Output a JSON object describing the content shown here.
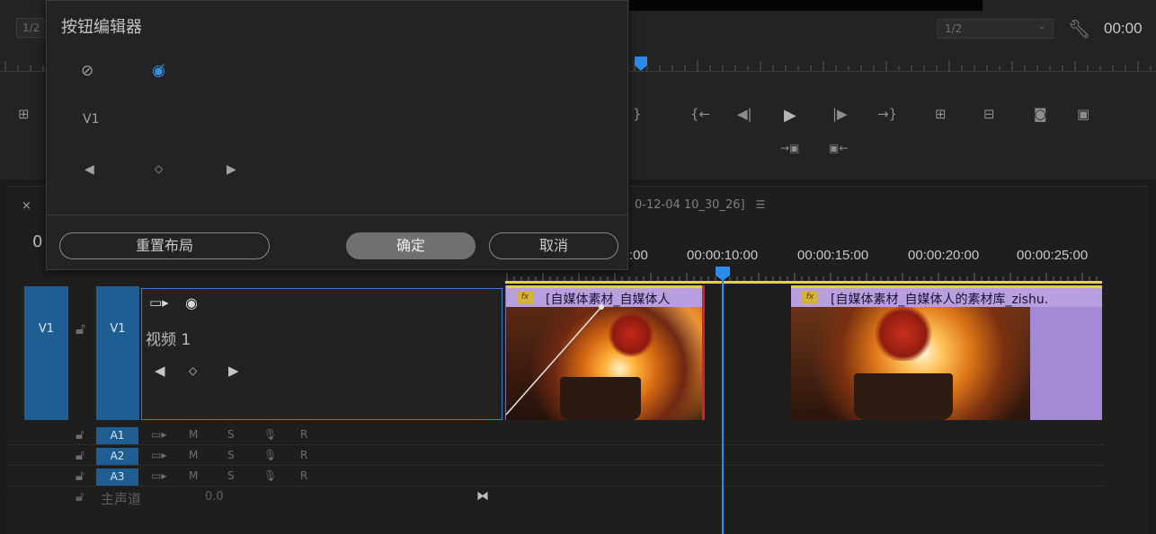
{
  "monitor": {
    "zoom": "1/2",
    "resolution": "1/2",
    "timecode": "00:00",
    "controls": [
      "{",
      "{←",
      "◀|",
      "▶",
      "|▶",
      "→}",
      "lift",
      "extract",
      "export-frame",
      "compare"
    ],
    "sub_controls": [
      "insert",
      "overwrite"
    ]
  },
  "dialog": {
    "title": "按钮编辑器",
    "track_label": "V1",
    "reset_label": "重置布局",
    "ok_label": "确定",
    "cancel_label": "取消"
  },
  "timeline": {
    "close": "×",
    "sequence_name": "0-12-04 10_30_26]",
    "timecode": "0",
    "ruler_labels": [
      ":00",
      "00:00:10:00",
      "00:00:15:00",
      "00:00:20:00",
      "00:00:25:00"
    ],
    "video_track": {
      "source_label": "V1",
      "target_label": "V1",
      "name": "视频 1"
    },
    "audio_tracks": [
      {
        "label": "A1",
        "m": "M",
        "s": "S",
        "r": "R"
      },
      {
        "label": "A2",
        "m": "M",
        "s": "S",
        "r": "R"
      },
      {
        "label": "A3",
        "m": "M",
        "s": "S",
        "r": "R"
      }
    ],
    "master": {
      "label": "主声道",
      "value": "0.0"
    },
    "clips": [
      {
        "fx": "fx",
        "title": "[自媒体素材_自媒体人"
      },
      {
        "fx": "fx",
        "title": "[自媒体素材_自媒体人的素材库_zishu."
      }
    ]
  },
  "colors": {
    "accent_blue": "#2d8ceb",
    "track_blue": "#1f5e93",
    "clip_header": "#b79fe0",
    "work_area": "#e1d341",
    "clip_end_red": "#d9202a"
  }
}
